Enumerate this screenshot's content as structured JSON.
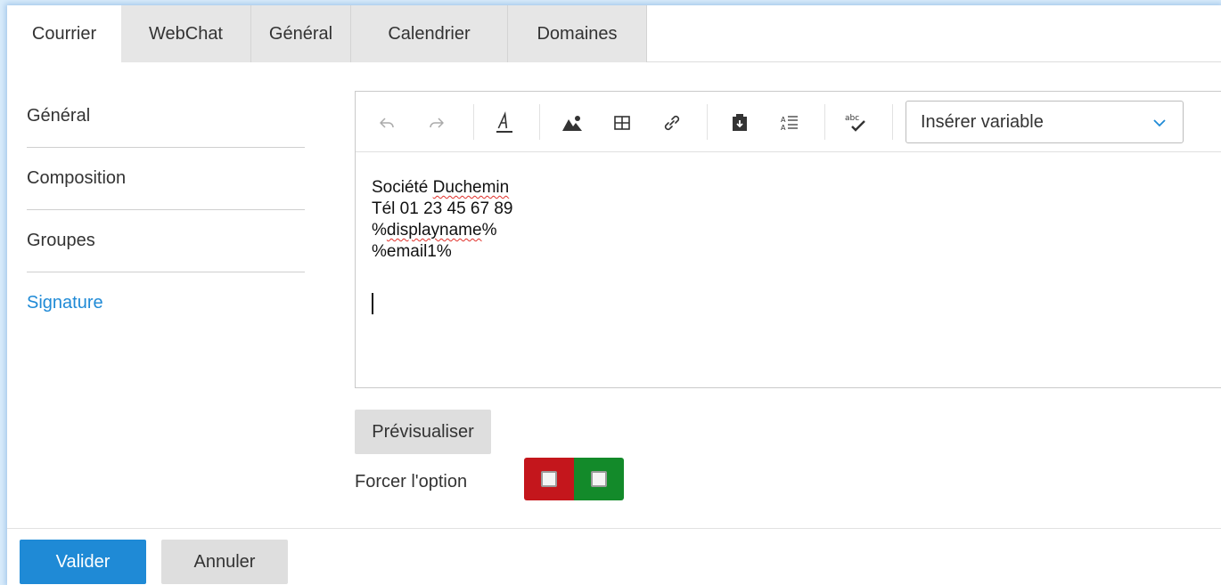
{
  "tabs": [
    {
      "label": "Courrier",
      "active": true
    },
    {
      "label": "WebChat",
      "active": false
    },
    {
      "label": "Général",
      "active": false
    },
    {
      "label": "Calendrier",
      "active": false
    },
    {
      "label": "Domaines",
      "active": false
    }
  ],
  "sidebar": {
    "items": [
      {
        "label": "Général",
        "active": false
      },
      {
        "label": "Composition",
        "active": false
      },
      {
        "label": "Groupes",
        "active": false
      },
      {
        "label": "Signature",
        "active": true
      }
    ]
  },
  "toolbar": {
    "icons": [
      "undo-icon",
      "redo-icon",
      "font-color-icon",
      "image-icon",
      "table-icon",
      "link-icon",
      "insert-template-icon",
      "paragraph-format-icon",
      "spellcheck-icon",
      "chevron-down-icon"
    ],
    "variable_select": "Insérer variable"
  },
  "editor": {
    "lines": [
      "Société Duchemin",
      "Tél 01 23 45 67 89",
      "%displayname%",
      "%email1%"
    ],
    "line1_prefix": "Société ",
    "line1_word": "Duchemin",
    "line3_prefix": "%",
    "line3_word": "displayname",
    "line3_suffix": "%"
  },
  "preview_button": "Prévisualiser",
  "force_option": {
    "label": "Forcer l'option",
    "red_checked": false,
    "green_checked": false
  },
  "footer": {
    "validate": "Valider",
    "cancel": "Annuler"
  },
  "colors": {
    "accent": "#1f8ad6",
    "red_toggle": "#c4161c",
    "green_toggle": "#138a2a"
  }
}
